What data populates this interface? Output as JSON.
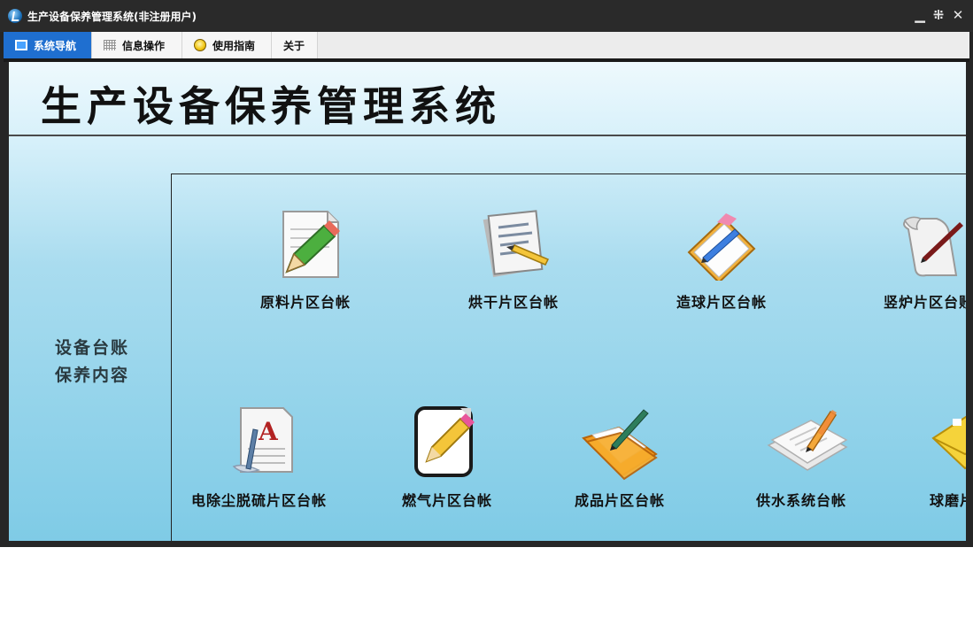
{
  "window": {
    "title": "生产设备保养管理系统(非注册用户)",
    "controls": {
      "minimize": "▁",
      "restore": "⁜",
      "close": "✕"
    }
  },
  "menu": {
    "tabs": [
      {
        "label": "系统导航",
        "icon": "monitor-icon",
        "active": true
      },
      {
        "label": "信息操作",
        "icon": "grid-icon",
        "active": false
      },
      {
        "label": "使用指南",
        "icon": "bulb-icon",
        "active": false
      },
      {
        "label": "关于",
        "icon": "",
        "active": false
      }
    ]
  },
  "main": {
    "title": "生产设备保养管理系统",
    "side_label": {
      "line1": "设备台账",
      "line2": "保养内容"
    },
    "items": [
      {
        "label": "原料片区台帐",
        "icon": "pencil-paper-icon"
      },
      {
        "label": "烘干片区台帐",
        "icon": "notepad-pencil-icon"
      },
      {
        "label": "造球片区台帐",
        "icon": "clipboard-pen-icon"
      },
      {
        "label": "竖炉片区台账",
        "icon": "scroll-quill-icon"
      },
      {
        "label": "电除尘脱硫片区台帐",
        "icon": "document-font-icon"
      },
      {
        "label": "燃气片区台帐",
        "icon": "edit-document-icon"
      },
      {
        "label": "成品片区台帐",
        "icon": "folder-pen-icon"
      },
      {
        "label": "供水系统台帐",
        "icon": "papers-pencil-icon"
      },
      {
        "label": "球磨片区台帐",
        "icon": "yellow-folder-icon"
      }
    ]
  },
  "colors": {
    "accent": "#1f6fd0",
    "titlebar": "#2a2a2a",
    "content_bg_top": "#eef9fd",
    "content_bg_bottom": "#7fcbe6"
  }
}
